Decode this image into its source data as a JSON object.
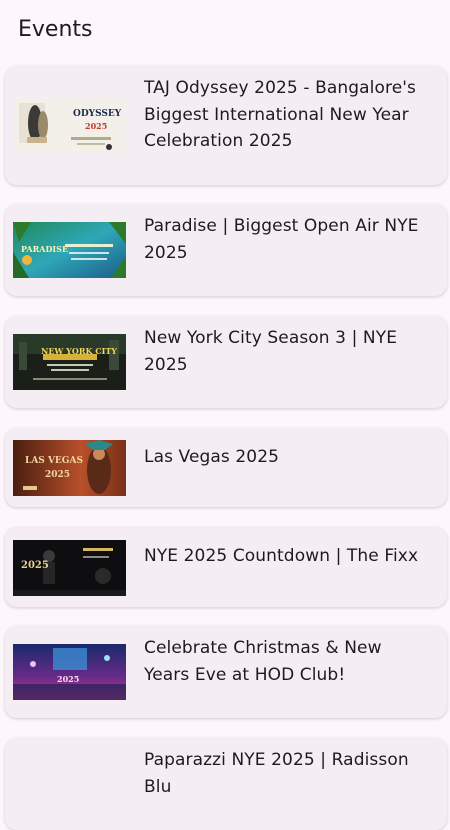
{
  "header": {
    "title": "Events"
  },
  "events": [
    {
      "title": "TAJ Odyssey 2025 - Bangalore's Biggest International New Year Celebration 2025",
      "thumb": {
        "text": "ODYSSEY",
        "subtext": "2025",
        "icon": "odyssey-poster-icon"
      }
    },
    {
      "title": "Paradise | Biggest Open Air NYE 2025",
      "thumb": {
        "text": "PARADISE",
        "subtext": "",
        "icon": "paradise-poster-icon"
      }
    },
    {
      "title": "New York City Season 3 | NYE 2025",
      "thumb": {
        "text": "NEW YORK CITY",
        "subtext": "",
        "icon": "new-york-city-poster-icon"
      }
    },
    {
      "title": "Las Vegas 2025",
      "thumb": {
        "text": "LAS VEGAS",
        "subtext": "2025",
        "icon": "las-vegas-poster-icon"
      }
    },
    {
      "title": "NYE 2025 Countdown | The Fixx",
      "thumb": {
        "text": "2025",
        "subtext": "",
        "icon": "fixx-poster-icon"
      }
    },
    {
      "title": "Celebrate Christmas & New Years Eve at HOD Club!",
      "thumb": {
        "text": "2025",
        "subtext": "",
        "icon": "hod-club-poster-icon"
      }
    },
    {
      "title": "Paparazzi NYE 2025 | Radisson Blu",
      "thumb": {
        "text": "",
        "subtext": "",
        "icon": "paparazzi-poster-icon"
      }
    }
  ]
}
